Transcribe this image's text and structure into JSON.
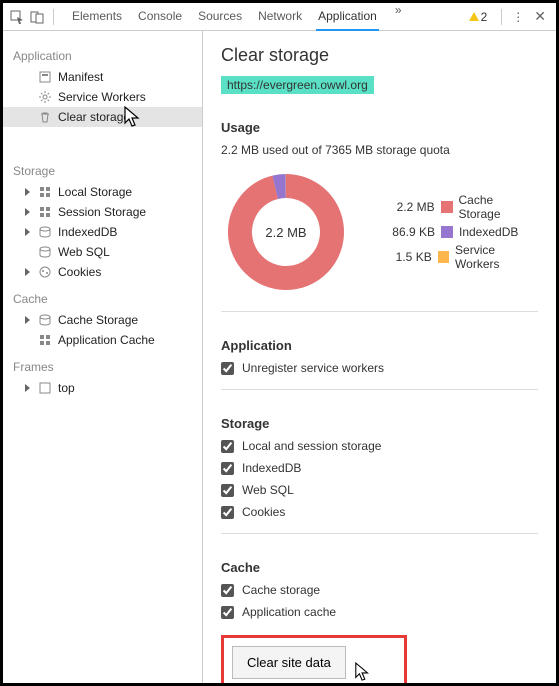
{
  "toolbar": {
    "tabs": [
      "Elements",
      "Console",
      "Sources",
      "Network",
      "Application"
    ],
    "activeTab": 4,
    "more": "»",
    "warnCount": "2"
  },
  "sidebar": {
    "groups": [
      {
        "title": "Application",
        "items": [
          {
            "icon": "manifest",
            "label": "Manifest"
          },
          {
            "icon": "gear",
            "label": "Service Workers"
          },
          {
            "icon": "trash",
            "label": "Clear storage",
            "selected": true
          }
        ]
      },
      {
        "title": "Storage",
        "items": [
          {
            "icon": "grid",
            "label": "Local Storage",
            "expandable": true
          },
          {
            "icon": "grid",
            "label": "Session Storage",
            "expandable": true
          },
          {
            "icon": "db",
            "label": "IndexedDB",
            "expandable": true
          },
          {
            "icon": "db",
            "label": "Web SQL"
          },
          {
            "icon": "cookie",
            "label": "Cookies",
            "expandable": true
          }
        ]
      },
      {
        "title": "Cache",
        "items": [
          {
            "icon": "db",
            "label": "Cache Storage",
            "expandable": true
          },
          {
            "icon": "grid",
            "label": "Application Cache"
          }
        ]
      },
      {
        "title": "Frames",
        "items": [
          {
            "icon": "frame",
            "label": "top",
            "expandable": true
          }
        ]
      }
    ]
  },
  "content": {
    "title": "Clear storage",
    "url": "https://evergreen.owwl.org",
    "usage": {
      "heading": "Usage",
      "summary": "2.2 MB used out of 7365 MB storage quota",
      "centerLabel": "2.2 MB"
    },
    "appSection": {
      "heading": "Application",
      "items": [
        "Unregister service workers"
      ]
    },
    "storageSection": {
      "heading": "Storage",
      "items": [
        "Local and session storage",
        "IndexedDB",
        "Web SQL",
        "Cookies"
      ]
    },
    "cacheSection": {
      "heading": "Cache",
      "items": [
        "Cache storage",
        "Application cache"
      ]
    },
    "clearButton": "Clear site data"
  },
  "chart_data": {
    "type": "pie",
    "title": "Usage",
    "series": [
      {
        "name": "Cache Storage",
        "value": 2.2,
        "unit": "MB",
        "color": "#e57373"
      },
      {
        "name": "IndexedDB",
        "value": 86.9,
        "unit": "KB",
        "color": "#9575cd"
      },
      {
        "name": "Service Workers",
        "value": 1.5,
        "unit": "KB",
        "color": "#ffb74d"
      }
    ],
    "centerLabel": "2.2 MB",
    "legend_position": "right"
  }
}
